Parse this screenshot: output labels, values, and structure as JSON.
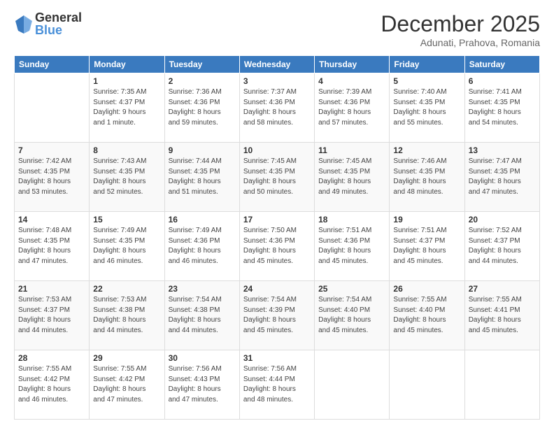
{
  "logo": {
    "general": "General",
    "blue": "Blue"
  },
  "header": {
    "month": "December 2025",
    "location": "Adunati, Prahova, Romania"
  },
  "weekdays": [
    "Sunday",
    "Monday",
    "Tuesday",
    "Wednesday",
    "Thursday",
    "Friday",
    "Saturday"
  ],
  "weeks": [
    [
      {
        "day": "",
        "info": ""
      },
      {
        "day": "1",
        "info": "Sunrise: 7:35 AM\nSunset: 4:37 PM\nDaylight: 9 hours\nand 1 minute."
      },
      {
        "day": "2",
        "info": "Sunrise: 7:36 AM\nSunset: 4:36 PM\nDaylight: 8 hours\nand 59 minutes."
      },
      {
        "day": "3",
        "info": "Sunrise: 7:37 AM\nSunset: 4:36 PM\nDaylight: 8 hours\nand 58 minutes."
      },
      {
        "day": "4",
        "info": "Sunrise: 7:39 AM\nSunset: 4:36 PM\nDaylight: 8 hours\nand 57 minutes."
      },
      {
        "day": "5",
        "info": "Sunrise: 7:40 AM\nSunset: 4:35 PM\nDaylight: 8 hours\nand 55 minutes."
      },
      {
        "day": "6",
        "info": "Sunrise: 7:41 AM\nSunset: 4:35 PM\nDaylight: 8 hours\nand 54 minutes."
      }
    ],
    [
      {
        "day": "7",
        "info": "Sunrise: 7:42 AM\nSunset: 4:35 PM\nDaylight: 8 hours\nand 53 minutes."
      },
      {
        "day": "8",
        "info": "Sunrise: 7:43 AM\nSunset: 4:35 PM\nDaylight: 8 hours\nand 52 minutes."
      },
      {
        "day": "9",
        "info": "Sunrise: 7:44 AM\nSunset: 4:35 PM\nDaylight: 8 hours\nand 51 minutes."
      },
      {
        "day": "10",
        "info": "Sunrise: 7:45 AM\nSunset: 4:35 PM\nDaylight: 8 hours\nand 50 minutes."
      },
      {
        "day": "11",
        "info": "Sunrise: 7:45 AM\nSunset: 4:35 PM\nDaylight: 8 hours\nand 49 minutes."
      },
      {
        "day": "12",
        "info": "Sunrise: 7:46 AM\nSunset: 4:35 PM\nDaylight: 8 hours\nand 48 minutes."
      },
      {
        "day": "13",
        "info": "Sunrise: 7:47 AM\nSunset: 4:35 PM\nDaylight: 8 hours\nand 47 minutes."
      }
    ],
    [
      {
        "day": "14",
        "info": "Sunrise: 7:48 AM\nSunset: 4:35 PM\nDaylight: 8 hours\nand 47 minutes."
      },
      {
        "day": "15",
        "info": "Sunrise: 7:49 AM\nSunset: 4:35 PM\nDaylight: 8 hours\nand 46 minutes."
      },
      {
        "day": "16",
        "info": "Sunrise: 7:49 AM\nSunset: 4:36 PM\nDaylight: 8 hours\nand 46 minutes."
      },
      {
        "day": "17",
        "info": "Sunrise: 7:50 AM\nSunset: 4:36 PM\nDaylight: 8 hours\nand 45 minutes."
      },
      {
        "day": "18",
        "info": "Sunrise: 7:51 AM\nSunset: 4:36 PM\nDaylight: 8 hours\nand 45 minutes."
      },
      {
        "day": "19",
        "info": "Sunrise: 7:51 AM\nSunset: 4:37 PM\nDaylight: 8 hours\nand 45 minutes."
      },
      {
        "day": "20",
        "info": "Sunrise: 7:52 AM\nSunset: 4:37 PM\nDaylight: 8 hours\nand 44 minutes."
      }
    ],
    [
      {
        "day": "21",
        "info": "Sunrise: 7:53 AM\nSunset: 4:37 PM\nDaylight: 8 hours\nand 44 minutes."
      },
      {
        "day": "22",
        "info": "Sunrise: 7:53 AM\nSunset: 4:38 PM\nDaylight: 8 hours\nand 44 minutes."
      },
      {
        "day": "23",
        "info": "Sunrise: 7:54 AM\nSunset: 4:38 PM\nDaylight: 8 hours\nand 44 minutes."
      },
      {
        "day": "24",
        "info": "Sunrise: 7:54 AM\nSunset: 4:39 PM\nDaylight: 8 hours\nand 45 minutes."
      },
      {
        "day": "25",
        "info": "Sunrise: 7:54 AM\nSunset: 4:40 PM\nDaylight: 8 hours\nand 45 minutes."
      },
      {
        "day": "26",
        "info": "Sunrise: 7:55 AM\nSunset: 4:40 PM\nDaylight: 8 hours\nand 45 minutes."
      },
      {
        "day": "27",
        "info": "Sunrise: 7:55 AM\nSunset: 4:41 PM\nDaylight: 8 hours\nand 45 minutes."
      }
    ],
    [
      {
        "day": "28",
        "info": "Sunrise: 7:55 AM\nSunset: 4:42 PM\nDaylight: 8 hours\nand 46 minutes."
      },
      {
        "day": "29",
        "info": "Sunrise: 7:55 AM\nSunset: 4:42 PM\nDaylight: 8 hours\nand 47 minutes."
      },
      {
        "day": "30",
        "info": "Sunrise: 7:56 AM\nSunset: 4:43 PM\nDaylight: 8 hours\nand 47 minutes."
      },
      {
        "day": "31",
        "info": "Sunrise: 7:56 AM\nSunset: 4:44 PM\nDaylight: 8 hours\nand 48 minutes."
      },
      {
        "day": "",
        "info": ""
      },
      {
        "day": "",
        "info": ""
      },
      {
        "day": "",
        "info": ""
      }
    ]
  ]
}
